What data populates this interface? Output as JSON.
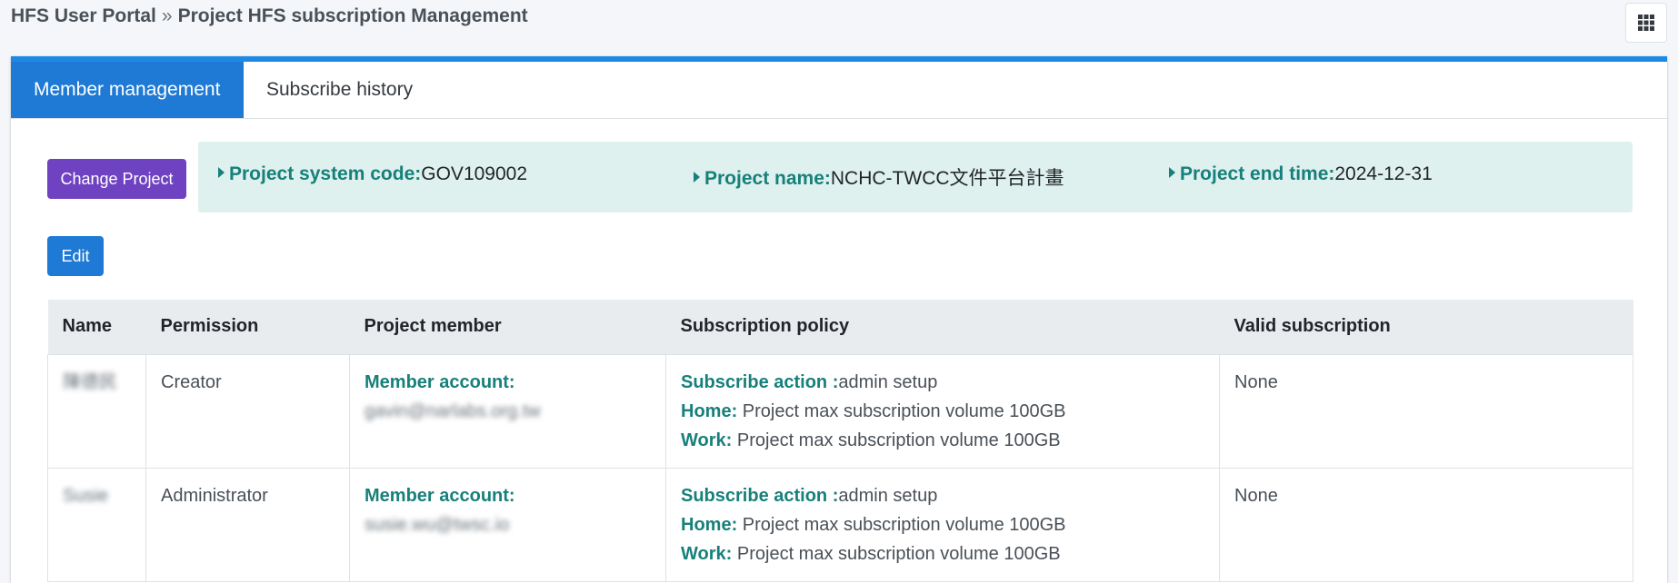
{
  "breadcrumb": {
    "root": "HFS User Portal",
    "separator": "»",
    "current": "Project HFS subscription Management"
  },
  "apps_button_icon": "grid-icon",
  "tabs": [
    {
      "label": "Member management",
      "active": true
    },
    {
      "label": "Subscribe history",
      "active": false
    }
  ],
  "buttons": {
    "change_project": "Change Project",
    "edit": "Edit"
  },
  "project_info": {
    "system_code_label": "Project system code:",
    "system_code": "GOV109002",
    "name_label": "Project name:",
    "name": "NCHC-TWCC文件平台計畫",
    "end_time_label": "Project end time:",
    "end_time": "2024-12-31"
  },
  "table": {
    "headers": [
      "Name",
      "Permission",
      "Project member",
      "Subscription policy",
      "Valid subscription"
    ],
    "rows": [
      {
        "name": "陳德民",
        "permission": "Creator",
        "member_label": "Member account:",
        "member_account": "gavin@narlabs.org.tw",
        "action_label": "Subscribe action :",
        "action_value": "admin setup",
        "home_label": "Home:",
        "home_value": "Project max subscription volume 100GB",
        "work_label": "Work:",
        "work_value": "Project max subscription volume 100GB",
        "valid": "None"
      },
      {
        "name": "Susie",
        "permission": "Administrator",
        "member_label": "Member account:",
        "member_account": "susie.wu@twsc.io",
        "action_label": "Subscribe action :",
        "action_value": "admin setup",
        "home_label": "Home:",
        "home_value": "Project max subscription volume 100GB",
        "work_label": "Work:",
        "work_value": "Project max subscription volume 100GB",
        "valid": "None"
      }
    ]
  },
  "colors": {
    "primary": "#1e7ad4",
    "purple": "#6f42c1",
    "teal": "#17807a",
    "info_bg": "#dff1ef"
  }
}
